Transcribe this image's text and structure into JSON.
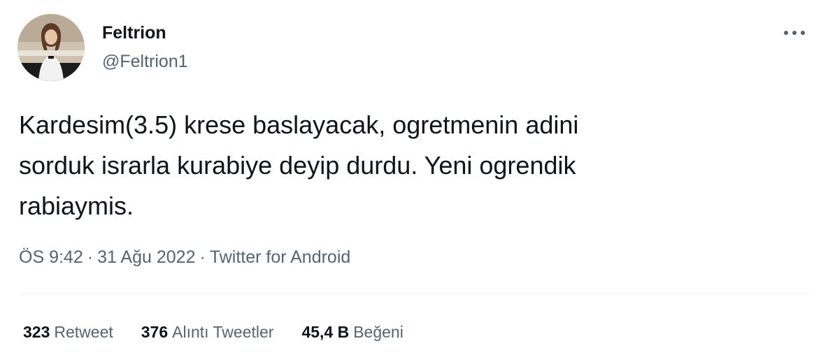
{
  "user": {
    "display_name": "Feltrion",
    "handle": "@Feltrion1"
  },
  "tweet": {
    "text": "Kardesim(3.5) krese baslayacak, ogretmenin adini\nsorduk israrla kurabiye deyip durdu. Yeni ogrendik\nrabiaymis."
  },
  "meta": {
    "time": "ÖS 9:42",
    "date": "31 Ağu 2022",
    "source": "Twitter for Android",
    "separator": "·"
  },
  "stats": {
    "retweets_count": "323",
    "retweets_label": "Retweet",
    "quotes_count": "376",
    "quotes_label": "Alıntı Tweetler",
    "likes_count": "45,4 B",
    "likes_label": "Beğeni"
  },
  "icons": {
    "more": "more-horizontal-icon"
  },
  "colors": {
    "primary_text": "#0f1419",
    "secondary_text": "#536471",
    "divider": "#eff3f4"
  }
}
